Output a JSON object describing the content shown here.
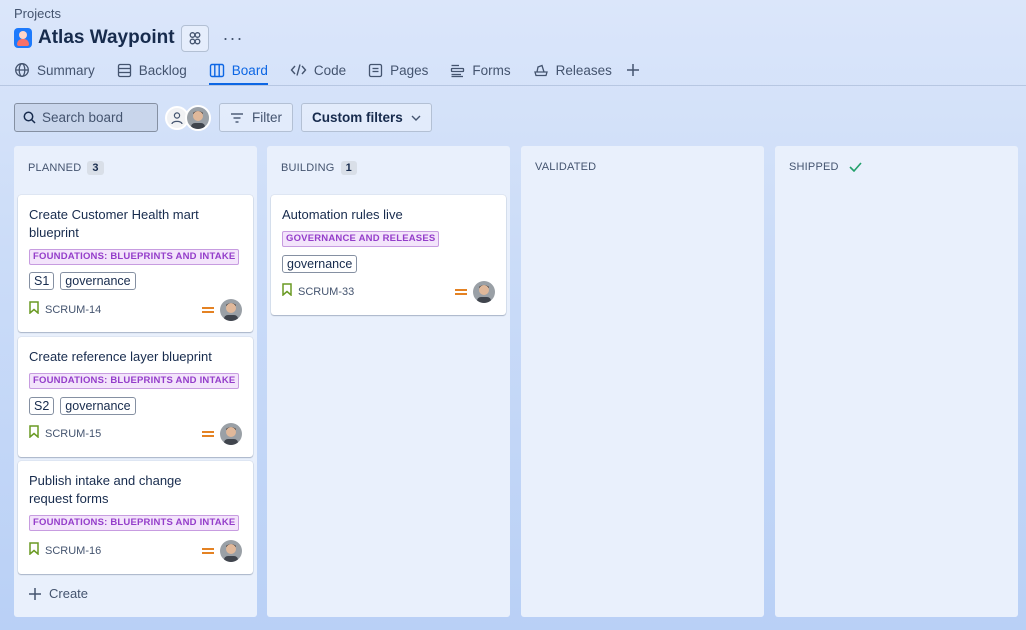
{
  "header": {
    "breadcrumb": "Projects",
    "project_title": "Atlas Waypoint",
    "more_label": "···"
  },
  "tabs": [
    {
      "label": "Summary",
      "icon": "globe-icon"
    },
    {
      "label": "Backlog",
      "icon": "backlog-icon"
    },
    {
      "label": "Board",
      "icon": "board-icon",
      "active": true
    },
    {
      "label": "Code",
      "icon": "code-icon"
    },
    {
      "label": "Pages",
      "icon": "pages-icon"
    },
    {
      "label": "Forms",
      "icon": "forms-icon"
    },
    {
      "label": "Releases",
      "icon": "releases-icon"
    }
  ],
  "toolbar": {
    "search_placeholder": "Search board",
    "filter_label": "Filter",
    "custom_filters_label": "Custom filters"
  },
  "colors": {
    "accent": "#0c66e4",
    "epic_text": "#943dca",
    "epic_bg": "#f3e4fb",
    "story_icon": "#6a9a23",
    "priority_medium": "#e2740b",
    "done_check": "#22a06b"
  },
  "columns": [
    {
      "title": "PLANNED",
      "count": "3",
      "cards": [
        {
          "title": "Create Customer Health mart blueprint",
          "epic": "FOUNDATIONS: BLUEPRINTS AND INTAKE",
          "tags": [
            "S1",
            "governance"
          ],
          "key": "SCRUM-14"
        },
        {
          "title": "Create reference layer blueprint",
          "epic": "FOUNDATIONS: BLUEPRINTS AND INTAKE",
          "tags": [
            "S2",
            "governance"
          ],
          "key": "SCRUM-15"
        },
        {
          "title": "Publish intake and change request forms",
          "epic": "FOUNDATIONS: BLUEPRINTS AND INTAKE",
          "tags": [],
          "key": "SCRUM-16"
        }
      ],
      "create_label": "Create"
    },
    {
      "title": "BUILDING",
      "count": "1",
      "cards": [
        {
          "title": "Automation rules live",
          "epic": "GOVERNANCE AND RELEASES",
          "tags": [
            "governance"
          ],
          "key": "SCRUM-33"
        }
      ]
    },
    {
      "title": "VALIDATED",
      "cards": []
    },
    {
      "title": "SHIPPED",
      "done": true,
      "cards": []
    }
  ]
}
